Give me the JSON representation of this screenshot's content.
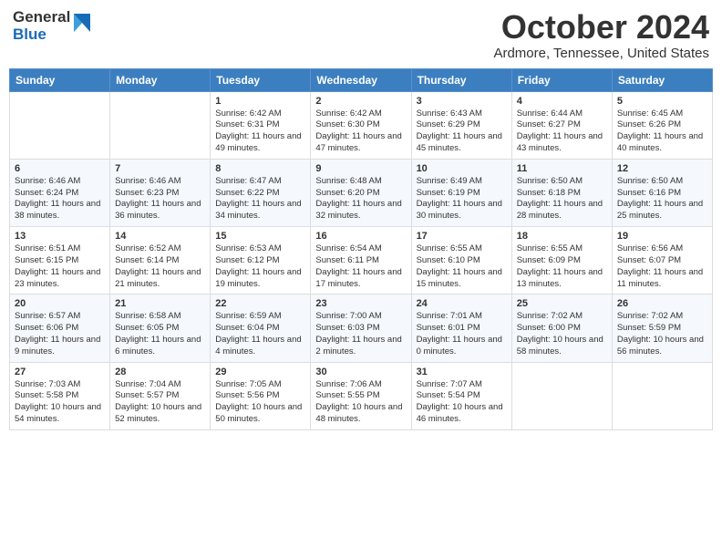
{
  "logo": {
    "general": "General",
    "blue": "Blue"
  },
  "title": {
    "month": "October 2024",
    "location": "Ardmore, Tennessee, United States"
  },
  "headers": [
    "Sunday",
    "Monday",
    "Tuesday",
    "Wednesday",
    "Thursday",
    "Friday",
    "Saturday"
  ],
  "weeks": [
    [
      {
        "day": "",
        "content": ""
      },
      {
        "day": "",
        "content": ""
      },
      {
        "day": "1",
        "content": "Sunrise: 6:42 AM\nSunset: 6:31 PM\nDaylight: 11 hours and 49 minutes."
      },
      {
        "day": "2",
        "content": "Sunrise: 6:42 AM\nSunset: 6:30 PM\nDaylight: 11 hours and 47 minutes."
      },
      {
        "day": "3",
        "content": "Sunrise: 6:43 AM\nSunset: 6:29 PM\nDaylight: 11 hours and 45 minutes."
      },
      {
        "day": "4",
        "content": "Sunrise: 6:44 AM\nSunset: 6:27 PM\nDaylight: 11 hours and 43 minutes."
      },
      {
        "day": "5",
        "content": "Sunrise: 6:45 AM\nSunset: 6:26 PM\nDaylight: 11 hours and 40 minutes."
      }
    ],
    [
      {
        "day": "6",
        "content": "Sunrise: 6:46 AM\nSunset: 6:24 PM\nDaylight: 11 hours and 38 minutes."
      },
      {
        "day": "7",
        "content": "Sunrise: 6:46 AM\nSunset: 6:23 PM\nDaylight: 11 hours and 36 minutes."
      },
      {
        "day": "8",
        "content": "Sunrise: 6:47 AM\nSunset: 6:22 PM\nDaylight: 11 hours and 34 minutes."
      },
      {
        "day": "9",
        "content": "Sunrise: 6:48 AM\nSunset: 6:20 PM\nDaylight: 11 hours and 32 minutes."
      },
      {
        "day": "10",
        "content": "Sunrise: 6:49 AM\nSunset: 6:19 PM\nDaylight: 11 hours and 30 minutes."
      },
      {
        "day": "11",
        "content": "Sunrise: 6:50 AM\nSunset: 6:18 PM\nDaylight: 11 hours and 28 minutes."
      },
      {
        "day": "12",
        "content": "Sunrise: 6:50 AM\nSunset: 6:16 PM\nDaylight: 11 hours and 25 minutes."
      }
    ],
    [
      {
        "day": "13",
        "content": "Sunrise: 6:51 AM\nSunset: 6:15 PM\nDaylight: 11 hours and 23 minutes."
      },
      {
        "day": "14",
        "content": "Sunrise: 6:52 AM\nSunset: 6:14 PM\nDaylight: 11 hours and 21 minutes."
      },
      {
        "day": "15",
        "content": "Sunrise: 6:53 AM\nSunset: 6:12 PM\nDaylight: 11 hours and 19 minutes."
      },
      {
        "day": "16",
        "content": "Sunrise: 6:54 AM\nSunset: 6:11 PM\nDaylight: 11 hours and 17 minutes."
      },
      {
        "day": "17",
        "content": "Sunrise: 6:55 AM\nSunset: 6:10 PM\nDaylight: 11 hours and 15 minutes."
      },
      {
        "day": "18",
        "content": "Sunrise: 6:55 AM\nSunset: 6:09 PM\nDaylight: 11 hours and 13 minutes."
      },
      {
        "day": "19",
        "content": "Sunrise: 6:56 AM\nSunset: 6:07 PM\nDaylight: 11 hours and 11 minutes."
      }
    ],
    [
      {
        "day": "20",
        "content": "Sunrise: 6:57 AM\nSunset: 6:06 PM\nDaylight: 11 hours and 9 minutes."
      },
      {
        "day": "21",
        "content": "Sunrise: 6:58 AM\nSunset: 6:05 PM\nDaylight: 11 hours and 6 minutes."
      },
      {
        "day": "22",
        "content": "Sunrise: 6:59 AM\nSunset: 6:04 PM\nDaylight: 11 hours and 4 minutes."
      },
      {
        "day": "23",
        "content": "Sunrise: 7:00 AM\nSunset: 6:03 PM\nDaylight: 11 hours and 2 minutes."
      },
      {
        "day": "24",
        "content": "Sunrise: 7:01 AM\nSunset: 6:01 PM\nDaylight: 11 hours and 0 minutes."
      },
      {
        "day": "25",
        "content": "Sunrise: 7:02 AM\nSunset: 6:00 PM\nDaylight: 10 hours and 58 minutes."
      },
      {
        "day": "26",
        "content": "Sunrise: 7:02 AM\nSunset: 5:59 PM\nDaylight: 10 hours and 56 minutes."
      }
    ],
    [
      {
        "day": "27",
        "content": "Sunrise: 7:03 AM\nSunset: 5:58 PM\nDaylight: 10 hours and 54 minutes."
      },
      {
        "day": "28",
        "content": "Sunrise: 7:04 AM\nSunset: 5:57 PM\nDaylight: 10 hours and 52 minutes."
      },
      {
        "day": "29",
        "content": "Sunrise: 7:05 AM\nSunset: 5:56 PM\nDaylight: 10 hours and 50 minutes."
      },
      {
        "day": "30",
        "content": "Sunrise: 7:06 AM\nSunset: 5:55 PM\nDaylight: 10 hours and 48 minutes."
      },
      {
        "day": "31",
        "content": "Sunrise: 7:07 AM\nSunset: 5:54 PM\nDaylight: 10 hours and 46 minutes."
      },
      {
        "day": "",
        "content": ""
      },
      {
        "day": "",
        "content": ""
      }
    ]
  ]
}
